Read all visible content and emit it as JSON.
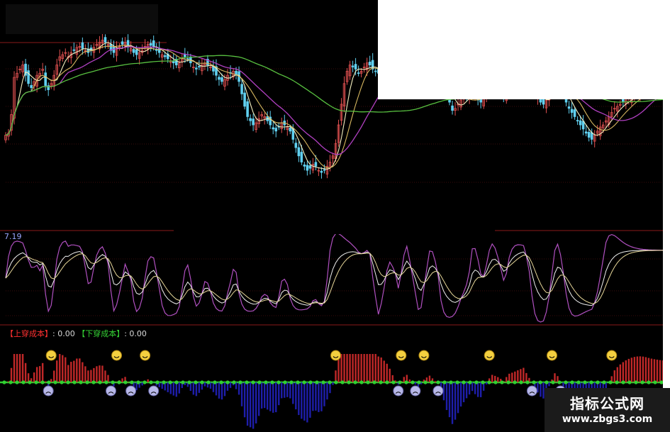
{
  "osc_value_text": "7.19",
  "cost_panel": {
    "up_label": "【上穿成本】",
    "up_value": ": 0.00",
    "down_label": "【下穿成本】",
    "down_value": ": 0.00"
  },
  "watermark": {
    "brand": "指标公式网",
    "url": "www.zbgs3.com"
  },
  "colors": {
    "background": "#000000",
    "up_candle": "#e05050",
    "down_candle": "#60d0f0",
    "ma_short": "#f5f0c0",
    "ma_mid": "#d8b860",
    "ma_long": "#b040c0",
    "ma_longer": "#58c040",
    "osc_fast": "#b050c0",
    "osc_mid": "#e8d89a",
    "osc_slow": "#f0f0f0",
    "hist_up": "#c02828",
    "hist_down": "#1e1eaa",
    "zero_line": "#30d030",
    "panel_divider": "#8a1a1a"
  },
  "chart_data": [
    {
      "type": "line",
      "name": "price",
      "x": [
        0,
        1,
        2,
        3,
        4,
        5,
        6,
        7,
        8,
        9,
        10,
        11,
        12,
        13,
        14,
        15,
        16,
        17,
        18,
        19,
        20,
        21,
        22,
        23,
        24,
        25,
        26,
        27,
        28,
        29,
        30,
        31,
        32,
        33,
        34,
        35,
        36,
        37,
        38,
        39,
        40,
        41,
        42,
        43,
        44,
        45,
        46,
        47,
        48,
        49,
        50,
        51,
        52,
        53,
        54,
        55,
        56,
        57,
        58,
        59,
        60,
        61,
        62,
        63,
        64,
        65,
        66,
        67,
        68,
        69,
        70,
        71,
        72,
        73,
        74,
        75,
        76,
        77,
        78,
        79,
        80,
        81,
        82,
        83,
        84,
        85,
        86,
        87,
        88,
        89,
        90,
        91,
        92,
        93,
        94,
        95,
        96,
        97,
        98,
        99,
        100,
        101,
        102,
        103,
        104,
        105,
        106,
        107,
        108,
        109,
        110,
        111,
        112,
        113,
        114,
        115,
        116,
        117,
        118,
        119,
        120,
        121,
        122,
        123,
        124,
        125,
        126,
        127,
        128,
        129,
        130,
        131,
        132,
        133,
        134,
        135,
        136,
        137,
        138,
        139,
        140,
        141,
        142,
        143,
        144,
        145,
        146,
        147,
        148,
        149,
        150,
        151,
        152,
        153,
        154,
        155,
        156,
        157,
        158,
        159,
        160,
        161,
        162,
        163,
        164,
        165,
        166,
        167,
        168,
        169,
        170,
        171,
        172,
        173,
        174,
        175,
        176,
        177,
        178,
        179,
        180,
        181,
        182,
        183,
        184,
        185,
        186,
        187,
        188,
        189,
        190,
        191,
        192,
        193,
        194,
        195,
        196,
        197,
        198,
        199,
        200,
        201,
        202,
        203,
        204,
        205,
        206,
        207,
        208,
        209,
        210,
        211,
        212,
        213,
        214,
        215,
        216,
        217,
        218,
        219,
        220,
        221,
        222,
        223,
        224,
        225,
        226,
        227,
        228,
        229,
        230,
        231,
        232,
        233
      ],
      "close": [
        60,
        62,
        80,
        116,
        120,
        124,
        128,
        118,
        110,
        106,
        112,
        118,
        120,
        124,
        108,
        104,
        110,
        118,
        128,
        136,
        138,
        140,
        136,
        140,
        142,
        145,
        146,
        144,
        142,
        140,
        142,
        145,
        148,
        150,
        152,
        150,
        148,
        142,
        140,
        144,
        146,
        148,
        150,
        146,
        144,
        140,
        138,
        140,
        142,
        146,
        148,
        147,
        145,
        142,
        140,
        138,
        136,
        134,
        132,
        130,
        128,
        130,
        134,
        136,
        134,
        130,
        126,
        124,
        126,
        128,
        130,
        128,
        126,
        122,
        118,
        114,
        112,
        114,
        118,
        120,
        122,
        118,
        112,
        100,
        88,
        78,
        74,
        70,
        72,
        76,
        80,
        78,
        74,
        70,
        66,
        64,
        68,
        72,
        70,
        68,
        64,
        56,
        48,
        40,
        34,
        30,
        26,
        28,
        32,
        30,
        26,
        24,
        26,
        30,
        34,
        40,
        52,
        70,
        90,
        110,
        122,
        128,
        126,
        124,
        120,
        122,
        126,
        130,
        128,
        124,
        122,
        120,
        124,
        126,
        128,
        128,
        126,
        124,
        122,
        126,
        130,
        132,
        128,
        126,
        124,
        122,
        124,
        128,
        130,
        132,
        130,
        128,
        126,
        120,
        110,
        100,
        92,
        84,
        86,
        90,
        94,
        96,
        98,
        100,
        102,
        98,
        94,
        92,
        96,
        100,
        104,
        106,
        104,
        102,
        100,
        98,
        102,
        106,
        108,
        110,
        112,
        114,
        116,
        112,
        108,
        104,
        100,
        96,
        92,
        90,
        94,
        100,
        106,
        112,
        110,
        104,
        98,
        92,
        86,
        82,
        78,
        74,
        70,
        66,
        62,
        58,
        56,
        60,
        64,
        68,
        70,
        74,
        78,
        82,
        86,
        88,
        90,
        92,
        94,
        96,
        98,
        100,
        102,
        104,
        106,
        108,
        110,
        112,
        114,
        116,
        118,
        120
      ]
    },
    {
      "type": "line",
      "name": "oscillator",
      "ylim": [
        -30,
        110
      ],
      "series_note": "three smoothed lines",
      "x_count": 234
    },
    {
      "type": "bar",
      "name": "histogram",
      "x_count": 234
    }
  ]
}
